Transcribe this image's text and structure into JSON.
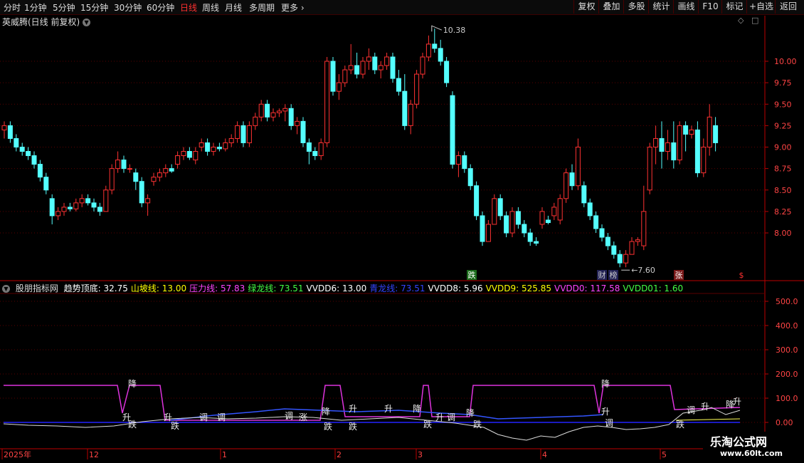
{
  "toolbar": {
    "periods": [
      "分时",
      "1分钟",
      "5分钟",
      "15分钟",
      "30分钟",
      "60分钟",
      "日线",
      "周线",
      "月线",
      "多周期",
      "更多"
    ],
    "active_period": "日线",
    "buttons": [
      "复权",
      "叠加",
      "多股",
      "统计",
      "画线",
      "F10",
      "标记",
      "+自选",
      "返回"
    ]
  },
  "title": "英威腾(日线 前复权)",
  "price_axis": [
    "10.00",
    "9.75",
    "9.50",
    "9.25",
    "9.00",
    "8.75",
    "8.50",
    "8.25",
    "8.00"
  ],
  "annotations": {
    "high": "10.38",
    "low": "7.60"
  },
  "event_labels": [
    "跌",
    "财",
    "榜",
    "张",
    "$"
  ],
  "indicator": {
    "name": "股朋指标网",
    "values": [
      {
        "label": "趋势顶底:",
        "value": "32.75",
        "color": "#ffffff"
      },
      {
        "label": "山坡线:",
        "value": "13.00",
        "color": "#ffff00"
      },
      {
        "label": "压力线:",
        "value": "57.83",
        "color": "#ff44ff"
      },
      {
        "label": "绿龙线:",
        "value": "73.51",
        "color": "#44ff44"
      },
      {
        "label": "VVDD6:",
        "value": "13.00",
        "color": "#ffffff"
      },
      {
        "label": "青龙线:",
        "value": "73.51",
        "color": "#3344ff"
      },
      {
        "label": "VVDD8:",
        "value": "5.96",
        "color": "#ffffff"
      },
      {
        "label": "VVDD9:",
        "value": "525.85",
        "color": "#ffff00"
      },
      {
        "label": "VVDD0:",
        "value": "117.58",
        "color": "#ff44ff"
      },
      {
        "label": "VVDD01:",
        "value": "1.60",
        "color": "#44ff44"
      }
    ]
  },
  "indicator_axis": [
    "500.0",
    "400.0",
    "300.0",
    "200.0",
    "100.0",
    "0.00"
  ],
  "signal_words": [
    "降",
    "升",
    "调",
    "跌",
    "涨"
  ],
  "date_axis": [
    "2025年",
    "12",
    "1",
    "2",
    "3",
    "4",
    "5"
  ],
  "watermark": {
    "line1": "乐淘公式网",
    "line2": "www.60lt.com"
  },
  "colors": {
    "up": "#ff3232",
    "down": "#54ffff",
    "grid": "#5a0000",
    "axis": "#bb0000",
    "active": "#ff3030"
  },
  "chart_data": {
    "type": "candlestick",
    "title": "英威腾(日线 前复权)",
    "ylim": [
      7.45,
      10.7
    ],
    "candles": [
      [
        9.2,
        9.3,
        9.1,
        9.25
      ],
      [
        9.25,
        9.3,
        9.05,
        9.1
      ],
      [
        9.1,
        9.15,
        8.95,
        9.0
      ],
      [
        9.0,
        9.05,
        8.9,
        8.95
      ],
      [
        8.95,
        9.0,
        8.85,
        8.9
      ],
      [
        8.9,
        8.95,
        8.75,
        8.8
      ],
      [
        8.8,
        8.85,
        8.6,
        8.65
      ],
      [
        8.65,
        8.7,
        8.45,
        8.5
      ],
      [
        8.4,
        8.45,
        8.1,
        8.2
      ],
      [
        8.2,
        8.3,
        8.15,
        8.25
      ],
      [
        8.25,
        8.35,
        8.2,
        8.3
      ],
      [
        8.3,
        8.35,
        8.25,
        8.28
      ],
      [
        8.28,
        8.4,
        8.25,
        8.35
      ],
      [
        8.35,
        8.45,
        8.3,
        8.4
      ],
      [
        8.4,
        8.45,
        8.32,
        8.35
      ],
      [
        8.35,
        8.4,
        8.25,
        8.3
      ],
      [
        8.3,
        8.35,
        8.2,
        8.25
      ],
      [
        8.25,
        8.55,
        8.25,
        8.5
      ],
      [
        8.5,
        8.8,
        8.45,
        8.75
      ],
      [
        8.75,
        8.95,
        8.7,
        8.85
      ],
      [
        8.85,
        8.9,
        8.7,
        8.75
      ],
      [
        8.75,
        8.8,
        8.7,
        8.75
      ],
      [
        8.7,
        8.75,
        8.5,
        8.6
      ],
      [
        8.6,
        8.65,
        8.3,
        8.35
      ],
      [
        8.35,
        8.45,
        8.2,
        8.4
      ],
      [
        8.6,
        8.7,
        8.55,
        8.65
      ],
      [
        8.65,
        8.75,
        8.6,
        8.7
      ],
      [
        8.7,
        8.8,
        8.65,
        8.75
      ],
      [
        8.75,
        8.8,
        8.7,
        8.72
      ],
      [
        8.8,
        8.95,
        8.75,
        8.9
      ],
      [
        8.9,
        9.0,
        8.85,
        8.95
      ],
      [
        8.95,
        9.0,
        8.85,
        8.88
      ],
      [
        8.85,
        9.0,
        8.8,
        8.95
      ],
      [
        9.0,
        9.1,
        8.95,
        9.05
      ],
      [
        9.05,
        9.1,
        8.9,
        8.95
      ],
      [
        8.95,
        9.05,
        8.9,
        9.0
      ],
      [
        9.0,
        9.05,
        8.95,
        8.98
      ],
      [
        8.98,
        9.1,
        8.95,
        9.05
      ],
      [
        9.05,
        9.15,
        9.0,
        9.1
      ],
      [
        9.1,
        9.3,
        9.05,
        9.25
      ],
      [
        9.25,
        9.3,
        9.0,
        9.05
      ],
      [
        9.05,
        9.3,
        9.0,
        9.25
      ],
      [
        9.25,
        9.4,
        9.2,
        9.35
      ],
      [
        9.35,
        9.55,
        9.3,
        9.5
      ],
      [
        9.5,
        9.55,
        9.3,
        9.35
      ],
      [
        9.35,
        9.45,
        9.3,
        9.4
      ],
      [
        9.4,
        9.45,
        9.35,
        9.42
      ],
      [
        9.42,
        9.5,
        9.3,
        9.45
      ],
      [
        9.45,
        9.5,
        9.2,
        9.25
      ],
      [
        9.25,
        9.35,
        9.15,
        9.3
      ],
      [
        9.3,
        9.35,
        9.0,
        9.05
      ],
      [
        9.05,
        9.1,
        8.8,
        8.95
      ],
      [
        8.95,
        9.0,
        8.85,
        8.9
      ],
      [
        8.9,
        9.1,
        8.85,
        9.05
      ],
      [
        9.05,
        10.05,
        9.0,
        10.0
      ],
      [
        10.0,
        10.05,
        9.6,
        9.65
      ],
      [
        9.65,
        9.85,
        9.55,
        9.75
      ],
      [
        9.75,
        9.95,
        9.7,
        9.9
      ],
      [
        9.9,
        10.2,
        9.85,
        9.95
      ],
      [
        9.95,
        10.1,
        9.8,
        9.85
      ],
      [
        9.85,
        10.05,
        9.8,
        10.0
      ],
      [
        10.0,
        10.15,
        9.9,
        10.05
      ],
      [
        10.05,
        10.1,
        9.85,
        9.9
      ],
      [
        9.9,
        10.0,
        9.8,
        9.95
      ],
      [
        9.95,
        10.1,
        9.9,
        10.05
      ],
      [
        10.05,
        10.1,
        9.75,
        9.8
      ],
      [
        9.8,
        9.9,
        9.6,
        9.65
      ],
      [
        9.65,
        9.85,
        9.2,
        9.25
      ],
      [
        9.25,
        9.55,
        9.15,
        9.5
      ],
      [
        9.5,
        9.9,
        9.45,
        9.85
      ],
      [
        9.85,
        10.1,
        9.8,
        10.05
      ],
      [
        10.05,
        10.3,
        10.0,
        10.2
      ],
      [
        10.2,
        10.38,
        10.1,
        10.15
      ],
      [
        10.15,
        10.25,
        9.95,
        10.0
      ],
      [
        10.0,
        10.05,
        9.7,
        9.75
      ],
      [
        9.6,
        9.65,
        8.75,
        8.8
      ],
      [
        8.8,
        8.95,
        8.65,
        8.9
      ],
      [
        8.9,
        8.95,
        8.7,
        8.75
      ],
      [
        8.75,
        8.8,
        8.5,
        8.55
      ],
      [
        8.55,
        8.6,
        8.15,
        8.2
      ],
      [
        8.2,
        8.25,
        7.85,
        7.9
      ],
      [
        7.9,
        8.15,
        7.9,
        8.1
      ],
      [
        8.1,
        8.45,
        8.1,
        8.4
      ],
      [
        8.4,
        8.45,
        8.15,
        8.2
      ],
      [
        8.2,
        8.25,
        7.95,
        8.0
      ],
      [
        8.0,
        8.3,
        7.95,
        8.25
      ],
      [
        8.25,
        8.3,
        8.05,
        8.1
      ],
      [
        8.1,
        8.15,
        7.95,
        8.0
      ],
      [
        8.0,
        8.05,
        7.85,
        7.9
      ],
      [
        7.9,
        7.95,
        7.85,
        7.88
      ],
      [
        8.1,
        8.3,
        8.05,
        8.25
      ],
      [
        8.15,
        8.2,
        8.1,
        8.12
      ],
      [
        8.2,
        8.35,
        8.15,
        8.3
      ],
      [
        8.15,
        8.45,
        8.1,
        8.4
      ],
      [
        8.4,
        8.75,
        8.35,
        8.7
      ],
      [
        8.7,
        8.8,
        8.5,
        8.55
      ],
      [
        8.55,
        9.1,
        8.5,
        9.0
      ],
      [
        8.55,
        8.6,
        8.3,
        8.35
      ],
      [
        8.35,
        8.4,
        8.15,
        8.2
      ],
      [
        8.2,
        8.25,
        8.0,
        8.05
      ],
      [
        8.05,
        8.1,
        7.9,
        7.95
      ],
      [
        7.95,
        8.0,
        7.8,
        7.85
      ],
      [
        7.85,
        7.9,
        7.7,
        7.75
      ],
      [
        7.75,
        7.8,
        7.6,
        7.65
      ],
      [
        7.65,
        7.8,
        7.6,
        7.75
      ],
      [
        7.75,
        7.95,
        7.75,
        7.9
      ],
      [
        7.9,
        7.95,
        7.85,
        7.92
      ],
      [
        7.85,
        8.55,
        7.8,
        8.25
      ],
      [
        8.5,
        9.05,
        8.45,
        9.0
      ],
      [
        9.0,
        9.25,
        8.8,
        9.1
      ],
      [
        9.1,
        9.3,
        8.75,
        8.95
      ],
      [
        8.95,
        9.2,
        8.85,
        9.05
      ],
      [
        9.05,
        9.3,
        8.75,
        8.85
      ],
      [
        8.85,
        9.3,
        8.8,
        9.25
      ],
      [
        9.25,
        9.3,
        8.95,
        9.15
      ],
      [
        9.15,
        9.25,
        9.1,
        9.2
      ],
      [
        9.2,
        9.3,
        8.65,
        8.7
      ],
      [
        8.7,
        9.1,
        8.65,
        9.0
      ],
      [
        9.0,
        9.5,
        8.9,
        9.35
      ],
      [
        9.25,
        9.35,
        8.95,
        9.05
      ]
    ]
  }
}
